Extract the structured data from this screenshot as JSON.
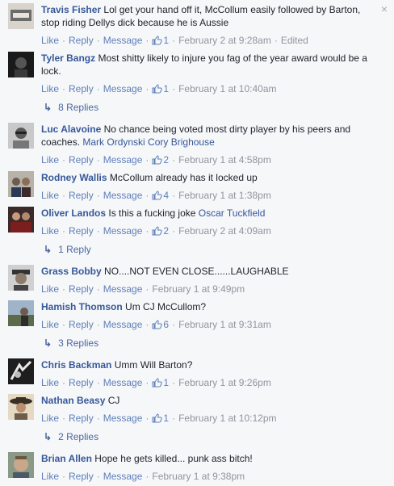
{
  "close_glyph": "×",
  "actions": {
    "like": "Like",
    "reply": "Reply",
    "message": "Message",
    "sep": "·"
  },
  "colors": {
    "link": "#365899",
    "meta": "#90949c",
    "background": "#f6f7f9"
  },
  "comments": [
    {
      "author": "Travis Fisher",
      "text": "Lol get your hand off it, McCollum easily followed by Barton, stop riding Dellys dick because he is Aussie",
      "likes": "1",
      "time": "February 2 at 9:28am",
      "edited": "Edited"
    },
    {
      "author": "Tyler Bangz",
      "text": "Most shitty likely to injure you fag of the year award would be a lock.",
      "likes": "1",
      "time": "February 1 at 10:40am"
    },
    {
      "author": "Luc Alavoine",
      "text": "No chance being voted most dirty player by his peers and coaches.",
      "mention": "Mark Ordynski Cory Brighouse",
      "likes": "2",
      "time": "February 1 at 4:58pm"
    },
    {
      "author": "Rodney Wallis",
      "text": "McCollum already has it locked up",
      "likes": "4",
      "time": "February 1 at 1:38pm"
    },
    {
      "author": "Oliver Landos",
      "text": "Is this a fucking joke",
      "mention": "Oscar Tuckfield",
      "likes": "2",
      "time": "February 2 at 4:09am"
    },
    {
      "author": "Grass Bobby",
      "text": "NO....NOT EVEN CLOSE......LAUGHABLE",
      "time": "February 1 at 9:49pm"
    },
    {
      "author": "Hamish Thomson",
      "text": "Um CJ McCullom?",
      "likes": "6",
      "time": "February 1 at 9:31am"
    },
    {
      "author": "Chris Backman",
      "text": "Umm Will Barton?",
      "likes": "1",
      "time": "February 1 at 9:26pm"
    },
    {
      "author": "Nathan Beasy",
      "text": "CJ",
      "likes": "1",
      "time": "February 1 at 10:12pm"
    },
    {
      "author": "Brian Allen",
      "text": "Hope he gets killed... punk ass bitch!",
      "time": "February 1 at 9:38pm"
    }
  ],
  "reply_links": [
    {
      "label": "8 Replies"
    },
    {
      "label": "1 Reply"
    },
    {
      "label": "3 Replies"
    },
    {
      "label": "2 Replies"
    }
  ]
}
